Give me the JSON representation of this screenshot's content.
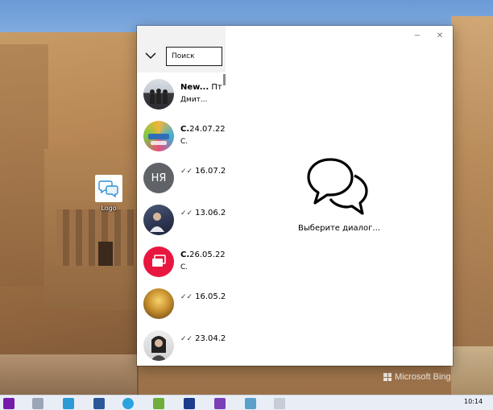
{
  "desktop": {
    "icon_label": "Logo",
    "watermark": "Microsoft Bing"
  },
  "window": {
    "controls": {
      "minimize": "−",
      "close": "✕"
    },
    "sidebar": {
      "search_placeholder": "Поиск",
      "chats": [
        {
          "title": "New...",
          "time": "Пт",
          "preview": "Дмит...",
          "avatar": "photo-group",
          "read_check": false
        },
        {
          "title": "С.",
          "time": "24.07.22",
          "preview": "С.",
          "avatar": "photo-colorful",
          "read_check": false
        },
        {
          "title": "",
          "initials": "НЯ",
          "time": "16.07.2",
          "preview": "",
          "avatar": "initials",
          "read_check": true
        },
        {
          "title": "",
          "time": "13.06.2",
          "preview": "",
          "avatar": "photo-person",
          "read_check": true
        },
        {
          "title": "С.",
          "time": "26.05.22",
          "preview": "С.",
          "avatar": "red-card",
          "read_check": false
        },
        {
          "title": "",
          "time": "16.05.2",
          "preview": "",
          "avatar": "photo-gold",
          "read_check": true
        },
        {
          "title": "",
          "time": "23.04.2",
          "preview": "",
          "avatar": "photo-woman",
          "read_check": true
        }
      ]
    },
    "main": {
      "empty_icon": "chat-bubbles-icon",
      "empty_text": "Выберите диалог..."
    }
  },
  "taskbar": {
    "clock": "10:14",
    "apps": [
      "onenote-icon",
      "file-icon",
      "app-icon",
      "word-icon",
      "telegram-icon",
      "notepad-icon",
      "save-icon",
      "visual-studio-icon",
      "app2-icon",
      "app3-icon"
    ]
  },
  "colors": {
    "initials_avatar": "#5f6368",
    "red_card": "#e8173f",
    "taskbar_bg": "#e9eef6"
  }
}
